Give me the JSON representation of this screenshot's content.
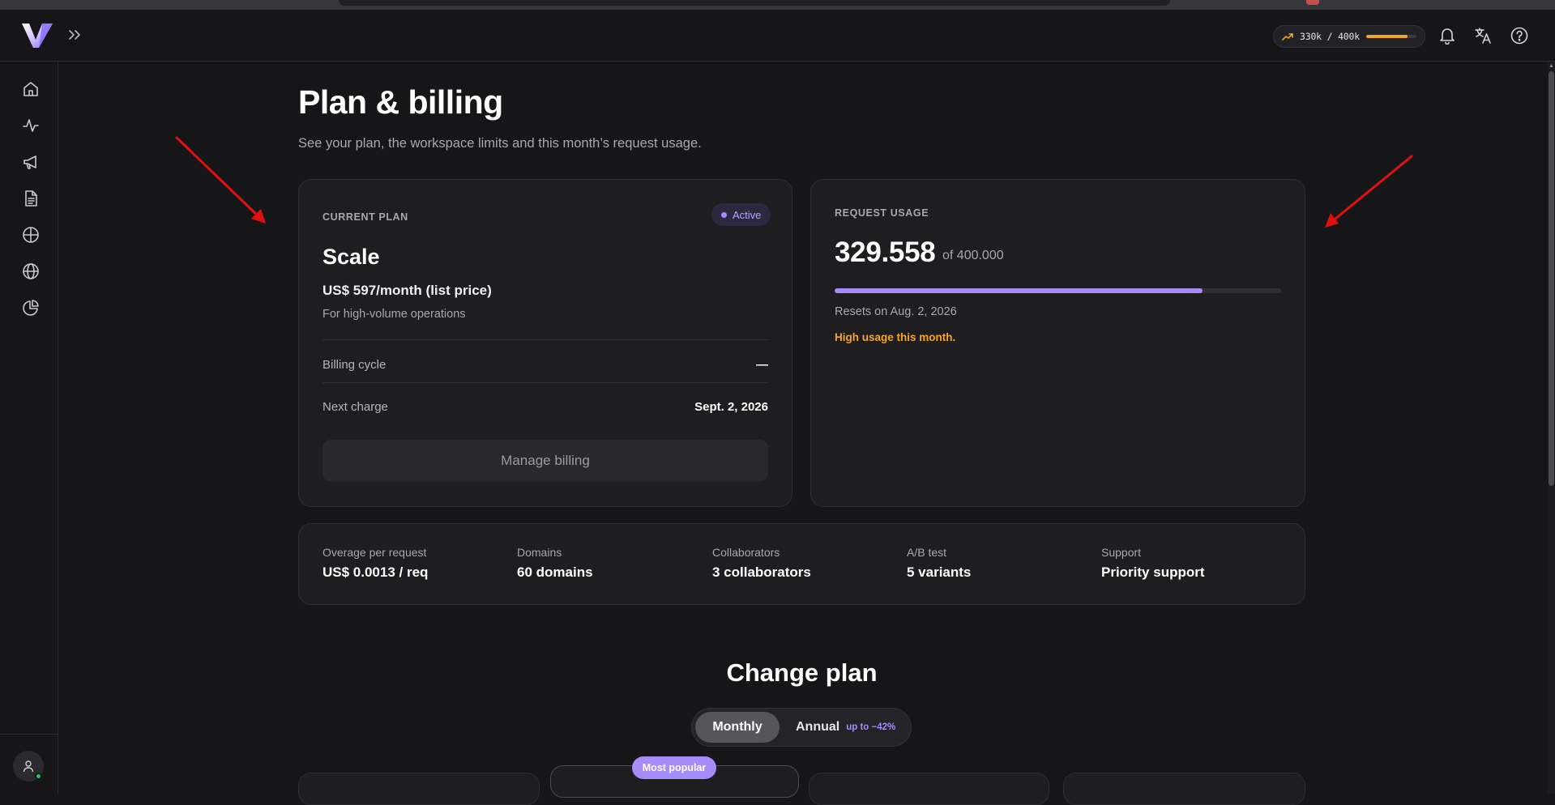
{
  "topbar": {
    "usage_pill": {
      "text": "330k / 400k",
      "fraction": 0.825,
      "accent": "#f5a524"
    },
    "icons": [
      "trending-up-icon",
      "bell-icon",
      "translate-icon",
      "help-icon"
    ]
  },
  "sidebar": {
    "items": [
      {
        "icon": "home-icon"
      },
      {
        "icon": "activity-icon"
      },
      {
        "icon": "megaphone-icon"
      },
      {
        "icon": "document-icon"
      },
      {
        "icon": "crosshair-icon"
      },
      {
        "icon": "globe-icon"
      },
      {
        "icon": "pie-chart-icon"
      }
    ],
    "avatar_icon": "user-icon"
  },
  "page": {
    "title": "Plan & billing",
    "subtitle": "See your plan, the workspace limits and this month’s request usage."
  },
  "current_plan": {
    "eyebrow": "CURRENT PLAN",
    "status": "Active",
    "name": "Scale",
    "price": "US$ 597/month (list price)",
    "description": "For high-volume operations",
    "rows": [
      {
        "label": "Billing cycle",
        "value": "—"
      },
      {
        "label": "Next charge",
        "value": "Sept. 2, 2026"
      }
    ],
    "manage_label": "Manage billing"
  },
  "request_usage": {
    "eyebrow": "REQUEST USAGE",
    "used": "329.558",
    "of_label": "of 400.000",
    "fraction": 0.8239,
    "reset_text": "Resets on Aug. 2, 2026",
    "warning": "High usage this month."
  },
  "limits": [
    {
      "label": "Overage per request",
      "value": "US$ 0.0013 / req"
    },
    {
      "label": "Domains",
      "value": "60 domains"
    },
    {
      "label": "Collaborators",
      "value": "3 collaborators"
    },
    {
      "label": "A/B test",
      "value": "5 variants"
    },
    {
      "label": "Support",
      "value": "Priority support"
    }
  ],
  "change_plan": {
    "title": "Change plan",
    "toggle": {
      "monthly": "Monthly",
      "annual": "Annual",
      "annual_discount": "up to −42%",
      "selected": "Monthly"
    },
    "featured_badge": "Most popular"
  },
  "colors": {
    "background": "#161619",
    "card": "#1e1e21",
    "accent_purple": "#a78bfa",
    "warning_orange": "#f5a524",
    "annotation_red": "#e01010"
  }
}
